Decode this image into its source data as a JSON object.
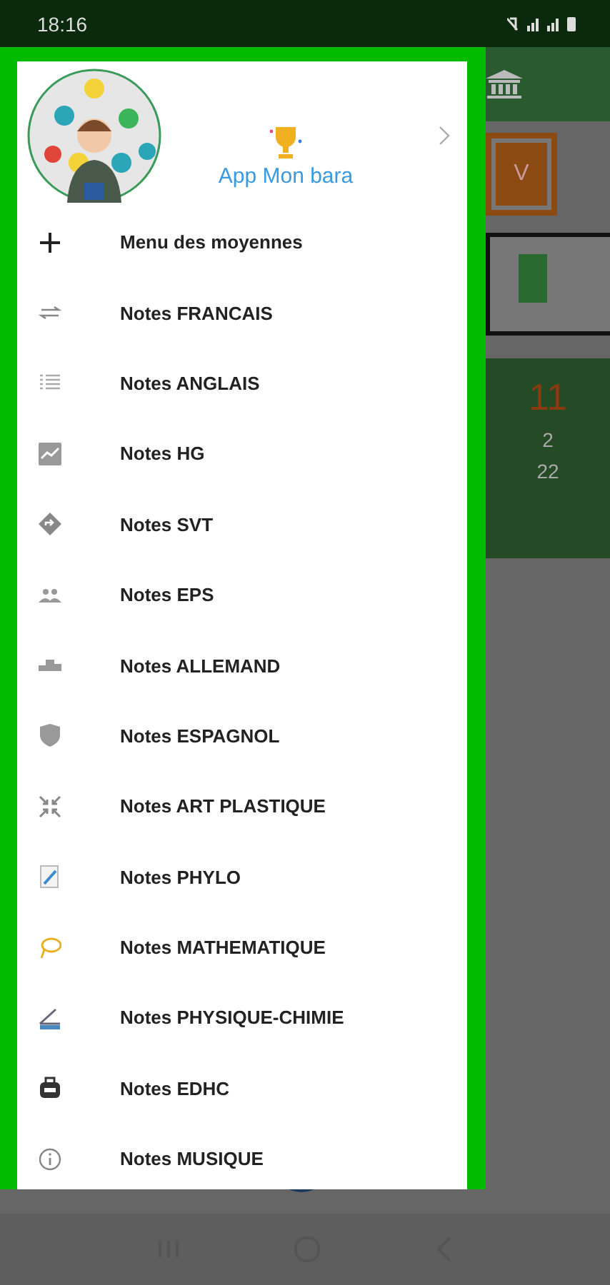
{
  "status_bar": {
    "time": "18:16"
  },
  "drawer": {
    "header": {
      "app_name": "App Mon bara"
    },
    "items": [
      {
        "label": "Menu des moyennes"
      },
      {
        "label": "Notes FRANCAIS"
      },
      {
        "label": "Notes ANGLAIS"
      },
      {
        "label": "Notes HG"
      },
      {
        "label": "Notes SVT"
      },
      {
        "label": "Notes EPS"
      },
      {
        "label": "Notes ALLEMAND"
      },
      {
        "label": "Notes ESPAGNOL"
      },
      {
        "label": "Notes ART PLASTIQUE"
      },
      {
        "label": "Notes PHYLO"
      },
      {
        "label": "Notes MATHEMATIQUE"
      },
      {
        "label": "Notes PHYSIQUE-CHIMIE"
      },
      {
        "label": "Notes EDHC"
      },
      {
        "label": "Notes MUSIQUE"
      }
    ]
  },
  "background": {
    "card_letter": "V",
    "score": "11",
    "values": [
      "2",
      "22"
    ]
  }
}
